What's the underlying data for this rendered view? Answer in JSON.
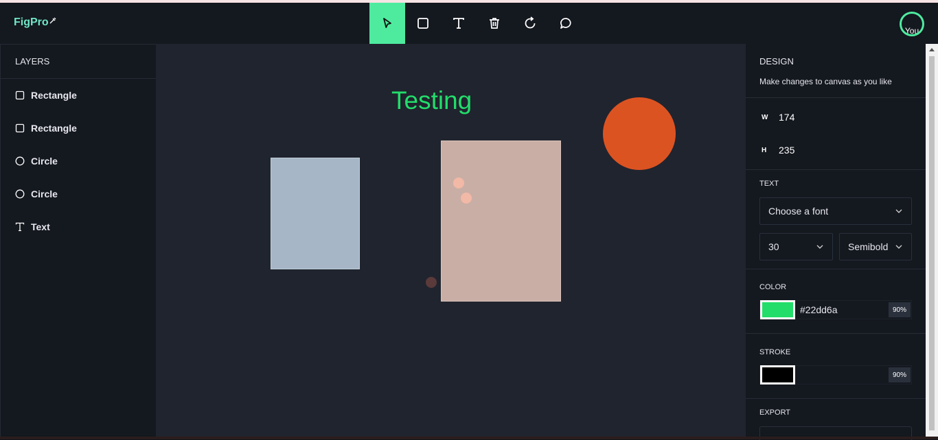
{
  "app": {
    "logo": "FigPro",
    "avatar_label": "You"
  },
  "toolbar": {
    "tools": [
      {
        "name": "select",
        "icon": "cursor-icon",
        "active": true
      },
      {
        "name": "rectangle",
        "icon": "square-icon"
      },
      {
        "name": "text",
        "icon": "text-icon"
      },
      {
        "name": "delete",
        "icon": "trash-icon"
      },
      {
        "name": "reset",
        "icon": "refresh-icon"
      },
      {
        "name": "comment",
        "icon": "comment-icon"
      }
    ],
    "accent": "#4eeb9f"
  },
  "layers": {
    "title": "LAYERS",
    "items": [
      {
        "label": "Rectangle",
        "icon": "square-icon"
      },
      {
        "label": "Rectangle",
        "icon": "square-icon"
      },
      {
        "label": "Circle",
        "icon": "circle-icon"
      },
      {
        "label": "Circle",
        "icon": "circle-icon"
      },
      {
        "label": "Text",
        "icon": "text-icon"
      }
    ]
  },
  "canvas": {
    "text": "Testing",
    "text_color": "#22dd6a",
    "shapes": [
      {
        "type": "rectangle",
        "color": "#a6b6c7"
      },
      {
        "type": "rectangle",
        "color": "#c9aea5"
      },
      {
        "type": "circle",
        "color": "#dc5322"
      }
    ],
    "reactions": [
      "heart-eyes-emoji",
      "heart-eyes-emoji",
      "smile-emoji"
    ]
  },
  "design": {
    "title": "DESIGN",
    "subtitle": "Make changes to canvas as you like",
    "width_label": "W",
    "width": "174",
    "height_label": "H",
    "height": "235",
    "text_section": "TEXT",
    "font_placeholder": "Choose a font",
    "font_size": "30",
    "font_weight": "Semibold",
    "color_section": "COLOR",
    "color_hex": "#22dd6a",
    "color_opacity": "90%",
    "stroke_section": "STROKE",
    "stroke_color": "#000000",
    "stroke_opacity": "90%",
    "export_section": "EXPORT"
  }
}
